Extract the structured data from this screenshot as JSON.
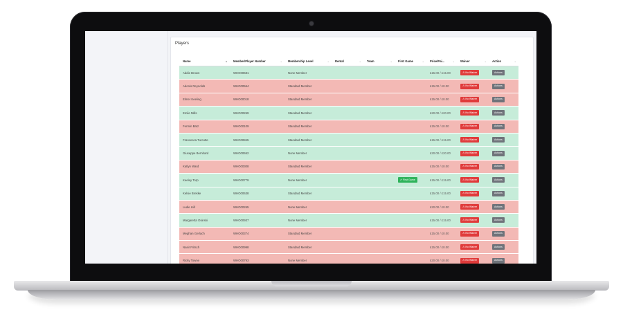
{
  "panel": {
    "title": "Players"
  },
  "columns": [
    {
      "label": "Name",
      "sort": "▲"
    },
    {
      "label": "Member/Player Number",
      "sort": "⌄"
    },
    {
      "label": "Membership Level",
      "sort": "⌄"
    },
    {
      "label": "Rental",
      "sort": "⌄"
    },
    {
      "label": "Team",
      "sort": "⌄"
    },
    {
      "label": "First Game",
      "sort": "⌄"
    },
    {
      "label": "Price/Pai...",
      "sort": "⌄"
    },
    {
      "label": "Waiver",
      "sort": "⌄"
    },
    {
      "label": "Action",
      "sort": "⌄"
    }
  ],
  "labels": {
    "no_waiver": "No Waiver",
    "actions": "Actions",
    "first_game": "First Game"
  },
  "icons": {
    "warning": "warning-icon",
    "check": "check-icon"
  },
  "colors": {
    "paid_row": "#c6ecd9",
    "unpaid_row": "#f3b9b5",
    "waiver_badge": "#e03b3b",
    "actions_button": "#6f737a",
    "first_game_badge": "#2fb35b"
  },
  "rows": [
    {
      "name": "Addie Brown",
      "number": "WHO00681",
      "level": "None Member",
      "first_game": false,
      "price": "£15.00 / £15.00",
      "status": "green"
    },
    {
      "name": "Adonis Reynolds",
      "number": "WHO00564",
      "level": "Standard Member",
      "first_game": false,
      "price": "£15.00 / £0.00",
      "status": "red"
    },
    {
      "name": "Elmer Keeling",
      "number": "WHO00018",
      "level": "Standard Member",
      "first_game": false,
      "price": "£15.00 / £0.00",
      "status": "red"
    },
    {
      "name": "Emile Mills",
      "number": "WHO00269",
      "level": "Standard Member",
      "first_game": false,
      "price": "£20.00 / £20.00",
      "status": "green"
    },
    {
      "name": "Fermin Batz",
      "number": "WHO00109",
      "level": "Standard Member",
      "first_game": false,
      "price": "£15.00 / £0.00",
      "status": "red"
    },
    {
      "name": "Francesca Turcotte",
      "number": "WHO00845",
      "level": "Standard Member",
      "first_game": false,
      "price": "£15.00 / £15.00",
      "status": "green"
    },
    {
      "name": "Giuseppe Bernhard",
      "number": "WHO00652",
      "level": "None Member",
      "first_game": false,
      "price": "£20.00 / £20.00",
      "status": "green"
    },
    {
      "name": "Katlyn Ward",
      "number": "WHO00308",
      "level": "Standard Member",
      "first_game": false,
      "price": "£15.00 / £0.00",
      "status": "red"
    },
    {
      "name": "Keeley Torp",
      "number": "WHO00779",
      "level": "None Member",
      "first_game": true,
      "price": "£15.00 / £15.00",
      "status": "green"
    },
    {
      "name": "Kelsie Brekke",
      "number": "WHO00638",
      "level": "Standard Member",
      "first_game": false,
      "price": "£15.00 / £15.00",
      "status": "green"
    },
    {
      "name": "Ludie Hill",
      "number": "WHO00265",
      "level": "None Member",
      "first_game": false,
      "price": "£20.00 / £0.00",
      "status": "red"
    },
    {
      "name": "Margaretta Osinski",
      "number": "WHO00937",
      "level": "None Member",
      "first_game": false,
      "price": "£15.00 / £15.00",
      "status": "green"
    },
    {
      "name": "Meghan Gerlach",
      "number": "WHO00374",
      "level": "Standard Member",
      "first_game": false,
      "price": "£15.00 / £0.00",
      "status": "red"
    },
    {
      "name": "Nasir Fritsch",
      "number": "WHO00998",
      "level": "Standard Member",
      "first_game": false,
      "price": "£15.00 / £0.00",
      "status": "red"
    },
    {
      "name": "Ricky Towne",
      "number": "WHO00793",
      "level": "None Member",
      "first_game": false,
      "price": "£20.00 / £0.00",
      "status": "red"
    },
    {
      "name": "Rosendo Ruecker",
      "number": "WHO00662",
      "level": "Standard Member",
      "first_game": false,
      "price": "£20.00 / £0.00",
      "status": "red"
    }
  ]
}
